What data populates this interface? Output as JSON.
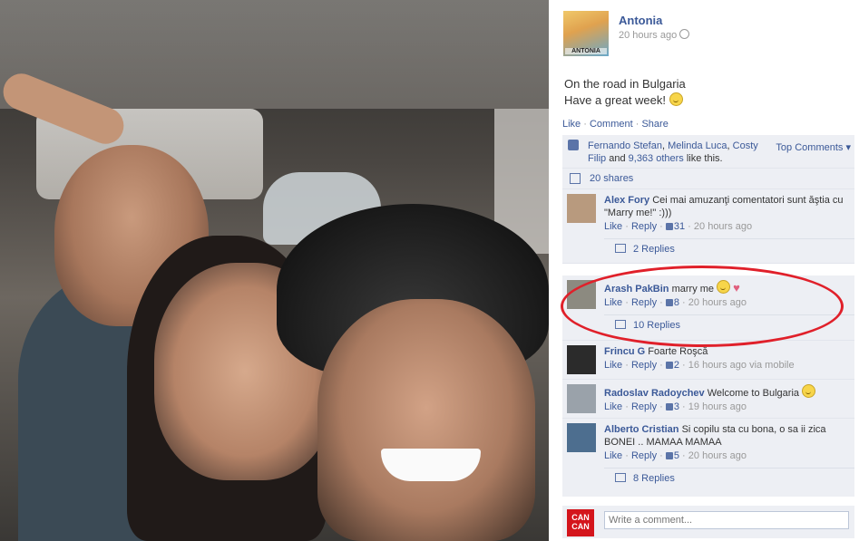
{
  "post": {
    "author": "Antonia",
    "avatar_text": "ANTONIA",
    "time": "20 hours ago",
    "text_line1": "On the road in Bulgaria",
    "text_line2": "Have a great week!",
    "actions": {
      "like": "Like",
      "comment": "Comment",
      "share": "Share"
    }
  },
  "likes": {
    "name1": "Fernando Stefan",
    "name2": "Melinda Luca",
    "name3": "Costy Filip",
    "and_text": " and ",
    "others": "9,363 others",
    "suffix": " like this.",
    "top_comments": "Top Comments"
  },
  "shares": "20 shares",
  "comments": [
    {
      "author": "Alex Fory",
      "text": "Cei mai amuzanţi comentatori sunt ăştia cu \"Marry me!\" :)))",
      "like": "Like",
      "reply": "Reply",
      "likes": "31",
      "time": "20 hours ago",
      "via": "",
      "replies": "2 Replies"
    },
    {
      "author": "Arash PakBin",
      "text": "marry me",
      "like": "Like",
      "reply": "Reply",
      "likes": "8",
      "time": "20 hours ago",
      "via": "",
      "replies": "10 Replies"
    },
    {
      "author": "Frincu G",
      "text": "Foarte Roşcă",
      "like": "Like",
      "reply": "Reply",
      "likes": "2",
      "time": "16 hours ago",
      "via": "via mobile",
      "replies": ""
    },
    {
      "author": "Radoslav Radoychev",
      "text": "Welcome to Bulgaria",
      "like": "Like",
      "reply": "Reply",
      "likes": "3",
      "time": "19 hours ago",
      "via": "",
      "replies": ""
    },
    {
      "author": "Alberto Cristian",
      "text": "Si copilu sta cu bona, o sa ii zica BONEI .. MAMAA MAMAA",
      "like": "Like",
      "reply": "Reply",
      "likes": "5",
      "time": "20 hours ago",
      "via": "",
      "replies": "8 Replies"
    }
  ],
  "composer": {
    "placeholder": "Write a comment...",
    "logo_text": "CAN CAN"
  },
  "colors": {
    "link": "#3b5998",
    "ufi_bg": "#edeff4",
    "annotation": "#e0202a"
  }
}
